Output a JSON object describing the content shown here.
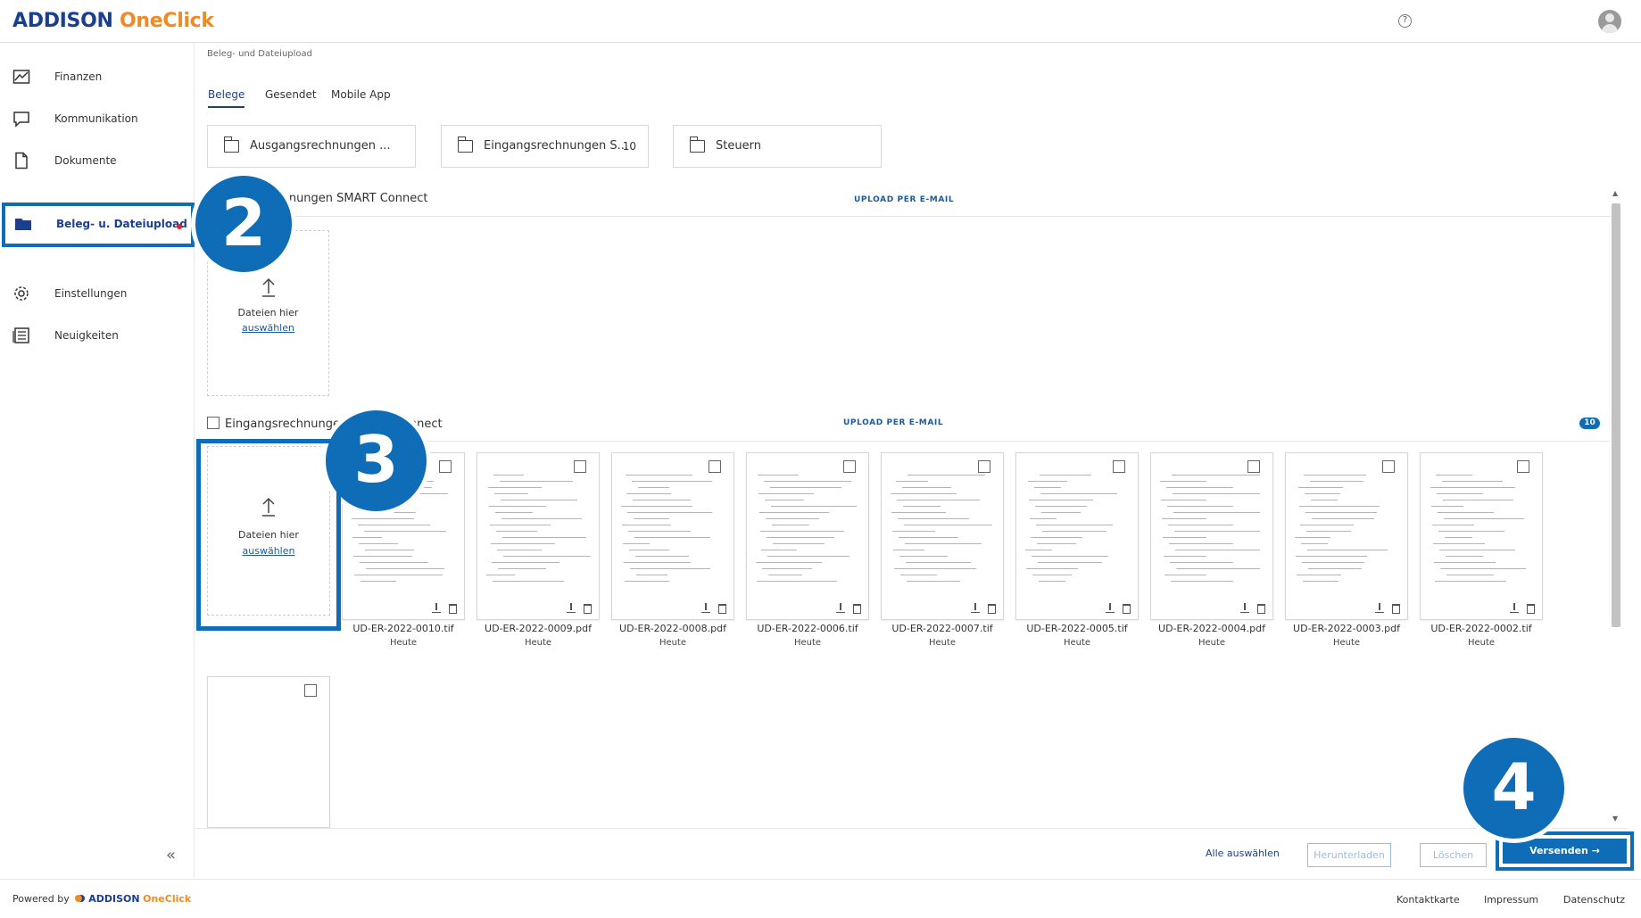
{
  "header": {
    "logo_part1": "ADDISON",
    "logo_part2": "OneClick",
    "help_glyph": "?"
  },
  "sidebar": {
    "items": [
      {
        "label": "Finanzen",
        "icon": "chart-icon"
      },
      {
        "label": "Kommunikation",
        "icon": "chat-icon"
      },
      {
        "label": "Dokumente",
        "icon": "document-icon"
      },
      {
        "label": "Beleg- u. Dateiupload",
        "icon": "folder-icon",
        "active": true
      },
      {
        "label": "Einstellungen",
        "icon": "gear-icon"
      },
      {
        "label": "Neuigkeiten",
        "icon": "news-icon"
      }
    ],
    "collapse_glyph": "«"
  },
  "main": {
    "breadcrumb": "Beleg- und Dateiupload",
    "tabs": [
      {
        "label": "Belege",
        "active": true
      },
      {
        "label": "Gesendet"
      },
      {
        "label": "Mobile App"
      }
    ],
    "folders": [
      {
        "label": "Ausgangsrechnungen ...",
        "count": ""
      },
      {
        "label": "Eingangsrechnungen S...",
        "count": "10"
      },
      {
        "label": "Steuern",
        "count": ""
      }
    ],
    "section1": {
      "title": "Ausgangsrechnungen SMART Connect",
      "upload_mail": "UPLOAD PER E-MAIL"
    },
    "section2": {
      "title": "Eingangsrechnungen SMART Connect",
      "upload_mail": "UPLOAD PER E-MAIL",
      "badge": "10"
    },
    "dropzone": {
      "line1": "Dateien hier",
      "line2": "auswählen"
    },
    "files": [
      {
        "name": "UD-ER-2022-0010.tif",
        "date": "Heute"
      },
      {
        "name": "UD-ER-2022-0009.pdf",
        "date": "Heute"
      },
      {
        "name": "UD-ER-2022-0008.pdf",
        "date": "Heute"
      },
      {
        "name": "UD-ER-2022-0006.tif",
        "date": "Heute"
      },
      {
        "name": "UD-ER-2022-0007.tif",
        "date": "Heute"
      },
      {
        "name": "UD-ER-2022-0005.tif",
        "date": "Heute"
      },
      {
        "name": "UD-ER-2022-0004.pdf",
        "date": "Heute"
      },
      {
        "name": "UD-ER-2022-0003.pdf",
        "date": "Heute"
      },
      {
        "name": "UD-ER-2022-0002.tif",
        "date": "Heute"
      }
    ]
  },
  "actions": {
    "select_all": "Alle auswählen",
    "download": "Herunterladen",
    "delete": "Löschen",
    "send": "Versenden →"
  },
  "footer": {
    "powered_by": "Powered by",
    "brand1": "ADDISON",
    "brand2": "OneClick",
    "links": [
      "Kontaktkarte",
      "Impressum",
      "Datenschutz"
    ]
  },
  "steps": [
    "2",
    "3",
    "4"
  ],
  "colors": {
    "brand_blue": "#1a3f8f",
    "brand_orange": "#f08a24",
    "accent": "#0f6cb6"
  }
}
